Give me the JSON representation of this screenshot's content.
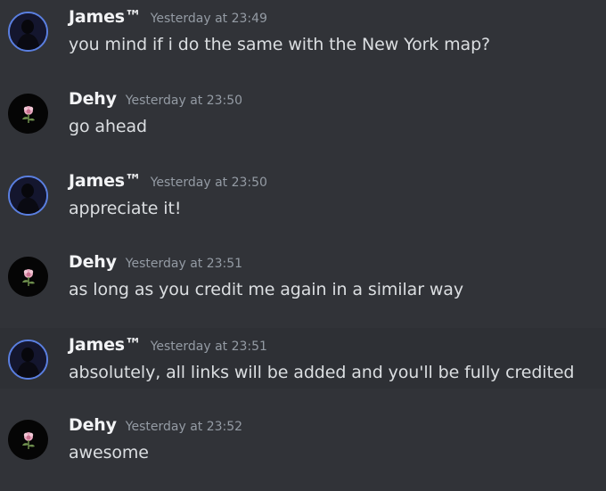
{
  "messages": [
    {
      "author": "James™",
      "timestamp": "Yesterday at 23:49",
      "text": "you mind if i do the same with the New York map?",
      "avatar_icon": "dark-portrait-avatar"
    },
    {
      "author": "Dehy",
      "timestamp": "Yesterday at 23:50",
      "text": "go ahead",
      "avatar_icon": "rose-icon"
    },
    {
      "author": "James™",
      "timestamp": "Yesterday at 23:50",
      "text": "appreciate it!",
      "avatar_icon": "dark-portrait-avatar"
    },
    {
      "author": "Dehy",
      "timestamp": "Yesterday at 23:51",
      "text": "as long as you credit me again in a similar way",
      "avatar_icon": "rose-icon"
    },
    {
      "author": "James™",
      "timestamp": "Yesterday at 23:51",
      "text": "absolutely, all links will be added and you'll be fully credited",
      "avatar_icon": "dark-portrait-avatar"
    },
    {
      "author": "Dehy",
      "timestamp": "Yesterday at 23:52",
      "text": "awesome",
      "avatar_icon": "rose-icon"
    }
  ],
  "colors": {
    "background": "#313338",
    "hover_row": "#2e3035",
    "username": "#f2f3f5",
    "timestamp": "#949ba4",
    "text": "#dbdee1",
    "avatar_ring": "#5a7fe0"
  }
}
